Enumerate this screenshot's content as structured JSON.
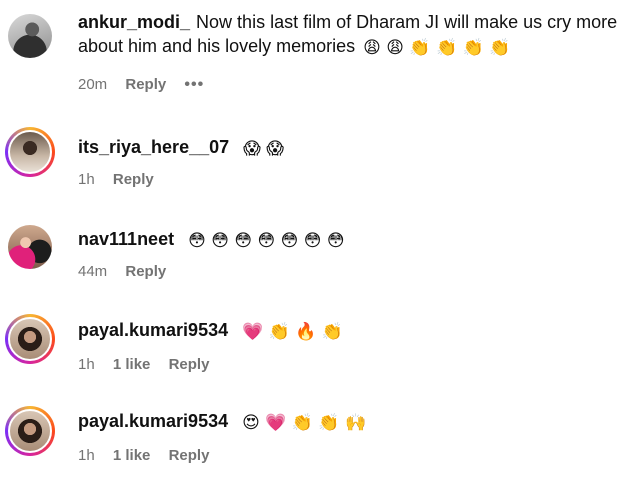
{
  "comments": [
    {
      "username": "ankur_modi_",
      "text": "Now this last film of Dharam JI will make us cry more about him and his lovely memories",
      "emoji": "😩😩👏👏👏👏",
      "time": "20m",
      "likes": "",
      "reply_label": "Reply",
      "more_label": "•••"
    },
    {
      "username": "its_riya_here__07",
      "text": "",
      "emoji": "😱😱",
      "time": "1h",
      "likes": "",
      "reply_label": "Reply"
    },
    {
      "username": "nav111neet",
      "text": "",
      "emoji": "😳😳😳😳😳😳😳",
      "time": "44m",
      "likes": "",
      "reply_label": "Reply"
    },
    {
      "username": "payal.kumari9534",
      "text": "",
      "emoji": "💗👏🔥👏",
      "time": "1h",
      "likes": "1 like",
      "reply_label": "Reply"
    },
    {
      "username": "payal.kumari9534",
      "text": "",
      "emoji": "😍💗👏👏🙌",
      "time": "1h",
      "likes": "1 like",
      "reply_label": "Reply"
    }
  ]
}
